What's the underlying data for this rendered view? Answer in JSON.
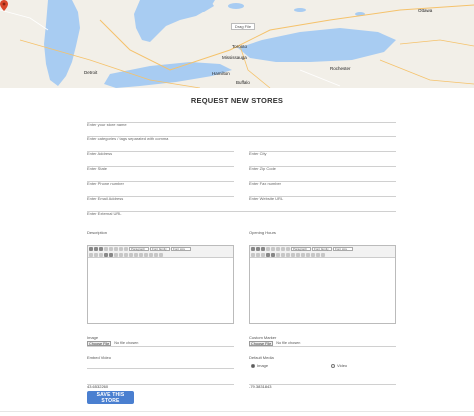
{
  "map": {
    "drag_label": "Drag File",
    "labels": [
      {
        "text": "Toronto",
        "cls": "city"
      },
      {
        "text": "Mississauga",
        "cls": "city"
      },
      {
        "text": "Hamilton",
        "cls": "city"
      },
      {
        "text": "Buffalo",
        "cls": "city"
      },
      {
        "text": "Rochester",
        "cls": "city"
      },
      {
        "text": "Detroit",
        "cls": "city"
      },
      {
        "text": "Ottawa",
        "cls": "city"
      }
    ]
  },
  "page_title": "REQUEST NEW STORES",
  "fields": {
    "store_name": "Enter your store name",
    "categories": "Enter categories / tags separated with comma",
    "address": "Enter Address",
    "city": "Enter City",
    "state": "Enter State",
    "zip": "Enter Zip Code",
    "phone": "Enter Phone number",
    "fax": "Enter Fax number",
    "email": "Enter Email Address",
    "website": "Enter Website URL",
    "external_url": "Enter External URL"
  },
  "labels": {
    "description": "Description",
    "opening_hours": "Opening Hours",
    "image": "Image",
    "custom_marker": "Custom Marker",
    "embed_video": "Embed Video",
    "default_media": "Default Media"
  },
  "editor": {
    "format_select": "Paragraph",
    "font_select": "Font family",
    "size_select": "Font size"
  },
  "file_inputs": {
    "button": "Choose File",
    "no_file": "No file chosen"
  },
  "default_media": {
    "image": "Image",
    "video": "Video"
  },
  "coords": {
    "lat": "43.6532260",
    "lng": "-79.3831843"
  },
  "save_button": "SAVE THIS STORE"
}
